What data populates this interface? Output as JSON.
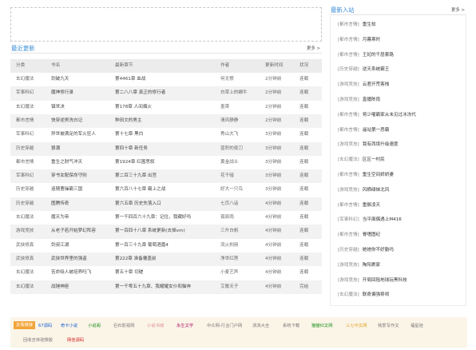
{
  "latest": {
    "title": "最近更新",
    "more": "更多 >",
    "headers": [
      "分类",
      "书名",
      "最新章节",
      "作者",
      "更新时间",
      "状况"
    ],
    "rows": [
      [
        "玄幻魔法",
        "剑破九天",
        "第4461章 血战",
        "何无恨",
        "2分钟前",
        "连载"
      ],
      [
        "军事科幻",
        "魔神修行录",
        "第二八八章 真正的修行者",
        "白草上的蜗牛",
        "2分钟前",
        "连载"
      ],
      [
        "玄幻魔法",
        "镇世决",
        "第178章 人间烟火",
        "墨霄",
        "2分钟前",
        "连载"
      ],
      [
        "都市言情",
        "快穿逆男洗白记",
        "种田文的男主",
        "清风静静",
        "2分钟前",
        "连载"
      ],
      [
        "军事科幻",
        "异世被满足的军火狂人",
        "第十七章 黑白",
        "秀山大飞",
        "3分钟前",
        "连载"
      ],
      [
        "历史穿越",
        "狼潮",
        "第四十章 新任务",
        "蓝积的夜刀",
        "3分钟前",
        "连载"
      ],
      [
        "都市言情",
        "重生之财气冲天",
        "第1924章 红围思叙",
        "黄金战士",
        "3分钟前",
        "连载"
      ],
      [
        "军事科幻",
        "穿书女配保命守则",
        "第二百三十九章 出宫",
        "花千暗",
        "3分钟前",
        "连载"
      ],
      [
        "历史穿越",
        "追随曹操霸三国",
        "第六百八十七章 霸上之战",
        "好大一只鸟",
        "3分钟前",
        "连载"
      ],
      [
        "历史穿越",
        "图腾传奇",
        "第六五章 历史失落入口",
        "七页八话",
        "4分钟前",
        "连载"
      ],
      [
        "玄幻魔法",
        "魔天为帝",
        "第一千四百六十九章：记住，我藏好吗",
        "孤辰雨",
        "4分钟前",
        "连载"
      ],
      [
        "游戏竞技",
        "从老子若开始梦幻阵容",
        "第一百四十八章 系统更新(去掉vm)",
        "三升白帆",
        "4分钟前",
        "连载"
      ],
      [
        "武侠修真",
        "剑叔江湖",
        "第一百三十九章 葡萄酒嘉4",
        "流火刹用",
        "4分钟前",
        "连载"
      ],
      [
        "武侠修真",
        "武侠世界里的强盗",
        "第222章 准备覆盖前",
        "净世红莲",
        "4分钟前",
        "连载"
      ],
      [
        "玄幻魔法",
        "苦命吸人被培养吗飞",
        "第五十章 切磋",
        "小麦艺声",
        "4分钟前",
        "连载"
      ],
      [
        "玄幻魔法",
        "战锤神座",
        "第一千零五十九章、我耀耀女仆和猫奔",
        "艾歌天子",
        "4分钟前",
        "完结"
      ]
    ]
  },
  "new_books": {
    "title": "最新入站",
    "more": "更多 >",
    "items": [
      [
        "[都市言情]",
        "重生劫"
      ],
      [
        "[都市言情]",
        "月暮寒时"
      ],
      [
        "[都市言情]",
        "王妃的千层套路"
      ],
      [
        "[历史穿越]",
        "逆天系统霸王"
      ],
      [
        "[游戏竞技]",
        "云君开荒客栈"
      ],
      [
        "[游戏竞技]",
        "直播陈雨"
      ],
      [
        "[都市言情]",
        "将少嚯霸家从未见过冰冻代"
      ],
      [
        "[都市言情]",
        "遥站第一恶霸"
      ],
      [
        "[游戏竞技]",
        "我有西境升级速度"
      ],
      [
        "[玄幻魔法]",
        "区区一村民"
      ],
      [
        "[都市言情]",
        "重生空间娇娇妻"
      ],
      [
        "[游戏竞技]",
        "风栖绿妹北风"
      ],
      [
        "[都市言情]",
        "重振凌天"
      ],
      [
        "[军事科幻]",
        "当平面偶遇上M416"
      ],
      [
        "[都市言情]",
        "脊嗜图纪"
      ],
      [
        "[历史穿越]",
        "她她你不好勤吗"
      ],
      [
        "[游戏竞技]",
        "陶阳裹家"
      ],
      [
        "[游戏竞技]",
        "开局回阻地球玩黑科技"
      ],
      [
        "[玄幻魔法]",
        "联奇偏强祭祠"
      ]
    ]
  },
  "links": {
    "tag": "友情链接",
    "items": [
      {
        "label": "67源码",
        "color": "#1a5fd0"
      },
      {
        "label": "奇卡小说",
        "color": "#1a5fd0"
      },
      {
        "label": "小说阁",
        "color": "#1a8f1a"
      },
      {
        "label": "巨石影视网",
        "color": "#777777"
      },
      {
        "label": "小说书城",
        "color": "#e08a9a"
      },
      {
        "label": "永生文学",
        "color": "#b0176a"
      },
      {
        "label": "中众网-行业门户网",
        "color": "#777777"
      },
      {
        "label": "涡涡大全",
        "color": "#777777"
      },
      {
        "label": "系统下载",
        "color": "#777777"
      },
      {
        "label": "猫猫红文网",
        "color": "#1a8f1a"
      },
      {
        "label": "三七中文网",
        "color": "#e0a020"
      },
      {
        "label": "我爱写作文",
        "color": "#777777"
      },
      {
        "label": "福星娃",
        "color": "#777777"
      },
      {
        "label": "回收吉林硅橡胶",
        "color": "#777777"
      },
      {
        "label": "网佳源码",
        "color": "#d02020"
      }
    ]
  }
}
